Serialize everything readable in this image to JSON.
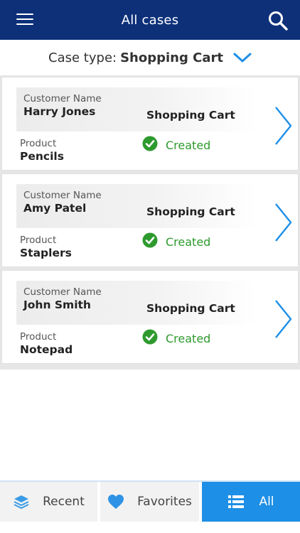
{
  "header": {
    "title": "All cases",
    "menu_icon": "hamburger-menu-icon",
    "search_icon": "search-icon",
    "bg_color": "#0d3079"
  },
  "filter": {
    "label": "Case type:",
    "value": "Shopping Cart",
    "icon": "chevron-down-icon",
    "accent": "#1e8fe6"
  },
  "cases": [
    {
      "customer_label": "Customer Name",
      "customer": "Harry Jones",
      "case_type": "Shopping Cart",
      "product_label": "Product",
      "product": "Pencils",
      "status": "Created"
    },
    {
      "customer_label": "Customer Name",
      "customer": "Amy Patel",
      "case_type": "Shopping Cart",
      "product_label": "Product",
      "product": "Staplers",
      "status": "Created"
    },
    {
      "customer_label": "Customer Name",
      "customer": "John Smith",
      "case_type": "Shopping Cart",
      "product_label": "Product",
      "product": "Notepad",
      "status": "Created"
    }
  ],
  "status_color": "#2e9a2e",
  "tabs": {
    "recent": {
      "label": "Recent",
      "icon": "layers-icon"
    },
    "favorites": {
      "label": "Favorites",
      "icon": "heart-icon"
    },
    "all": {
      "label": "All",
      "icon": "list-icon",
      "active": true
    }
  }
}
